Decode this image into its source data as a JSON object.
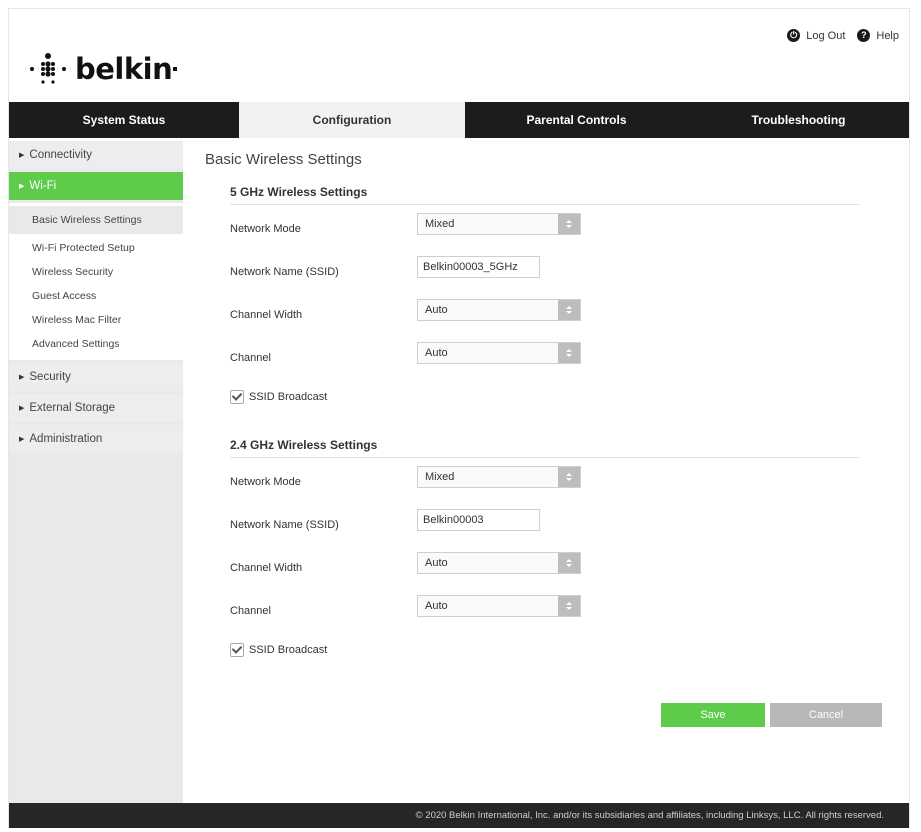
{
  "brand": {
    "name": "belkin",
    "logo_icon": "belkin-dots-logo"
  },
  "top_links": {
    "logout": {
      "label": "Log Out",
      "icon": "power-icon"
    },
    "help": {
      "label": "Help",
      "icon": "question-icon"
    }
  },
  "nav": {
    "tabs": [
      {
        "label": "System Status"
      },
      {
        "label": "Configuration"
      },
      {
        "label": "Parental Controls"
      },
      {
        "label": "Troubleshooting"
      }
    ],
    "active": "Configuration"
  },
  "sidebar": {
    "items": [
      {
        "label": "Connectivity"
      },
      {
        "label": "Wi-Fi"
      },
      {
        "label": "Security"
      },
      {
        "label": "External Storage"
      },
      {
        "label": "Administration"
      }
    ],
    "wifi_sub": [
      {
        "label": "Basic Wireless Settings"
      },
      {
        "label": "Wi-Fi Protected Setup"
      },
      {
        "label": "Wireless Security"
      },
      {
        "label": "Guest Access"
      },
      {
        "label": "Wireless Mac Filter"
      },
      {
        "label": "Advanced Settings"
      }
    ]
  },
  "main": {
    "title": "Basic Wireless Settings",
    "band5": {
      "title": "5 GHz Wireless Settings",
      "network_mode": {
        "label": "Network Mode",
        "value": "Mixed"
      },
      "ssid": {
        "label": "Network Name (SSID)",
        "value": "Belkin00003_5GHz"
      },
      "channel_width": {
        "label": "Channel Width",
        "value": "Auto"
      },
      "channel": {
        "label": "Channel",
        "value": "Auto"
      },
      "broadcast": {
        "label": "SSID Broadcast",
        "checked": true
      }
    },
    "band24": {
      "title": "2.4 GHz Wireless Settings",
      "network_mode": {
        "label": "Network Mode",
        "value": "Mixed"
      },
      "ssid": {
        "label": "Network Name (SSID)",
        "value": "Belkin00003"
      },
      "channel_width": {
        "label": "Channel Width",
        "value": "Auto"
      },
      "channel": {
        "label": "Channel",
        "value": "Auto"
      },
      "broadcast": {
        "label": "SSID Broadcast",
        "checked": true
      }
    },
    "buttons": {
      "save": "Save",
      "cancel": "Cancel"
    }
  },
  "footer": {
    "text": "© 2020 Belkin International, Inc. and/or its subsidiaries and affiliates, including Linksys, LLC. All rights reserved."
  },
  "colors": {
    "accent": "#5ecb4a",
    "nav_bg": "#1c1c1c",
    "footer_bg": "#262626",
    "cancel": "#b8b8b8"
  }
}
